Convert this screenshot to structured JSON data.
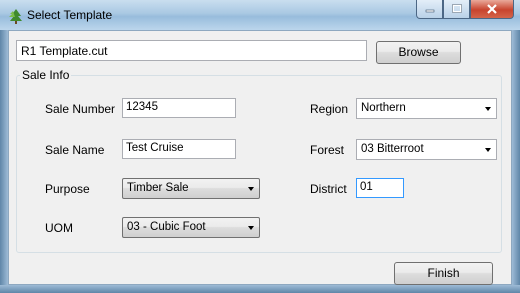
{
  "window": {
    "title": "Select Template",
    "icon": "tree-icon",
    "minimize_icon": "minimize-icon",
    "maximize_icon": "maximize-icon",
    "close_icon": "close-icon"
  },
  "template": {
    "path": "R1 Template.cut",
    "browse_label": "Browse"
  },
  "sale_info": {
    "legend": "Sale Info",
    "sale_number": {
      "label": "Sale Number",
      "value": "12345"
    },
    "sale_name": {
      "label": "Sale Name",
      "value": "Test Cruise"
    },
    "purpose": {
      "label": "Purpose",
      "value": "Timber Sale"
    },
    "uom": {
      "label": "UOM",
      "value": "03 - Cubic Foot"
    },
    "region": {
      "label": "Region",
      "value": "Northern"
    },
    "forest": {
      "label": "Forest",
      "value": "03 Bitterroot"
    },
    "district": {
      "label": "District",
      "value": "01"
    }
  },
  "actions": {
    "finish_label": "Finish"
  }
}
